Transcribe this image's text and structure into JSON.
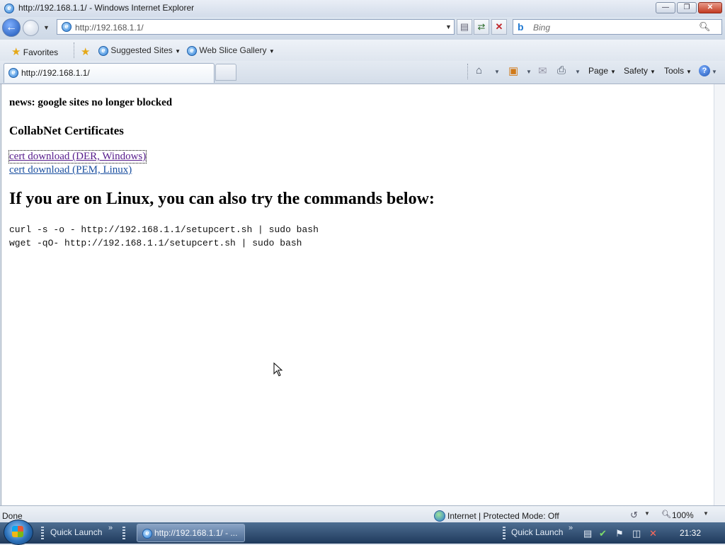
{
  "window": {
    "title": "http://192.168.1.1/ - Windows Internet Explorer",
    "minimize": "—",
    "maximize": "❐",
    "close": "✕"
  },
  "address_bar": {
    "url": "http://192.168.1.1/",
    "search_placeholder": "Bing"
  },
  "favorites_bar": {
    "favorites": "Favorites",
    "suggested_sites": "Suggested Sites",
    "web_slice_gallery": "Web Slice Gallery"
  },
  "tabs": [
    {
      "label": "http://192.168.1.1/"
    }
  ],
  "command_bar": {
    "page": "Page",
    "safety": "Safety",
    "tools": "Tools"
  },
  "page": {
    "news": "news: google sites no longer blocked",
    "heading_certs": "CollabNet Certificates",
    "link_der": "cert download (DER, Windows)",
    "link_pem": "cert download (PEM, Linux)",
    "heading_linux": "If you are on Linux, you can also try the commands below:",
    "command_1": "curl -s -o - http://192.168.1.1/setupcert.sh | sudo bash",
    "command_2": "wget -qO- http://192.168.1.1/setupcert.sh | sudo bash"
  },
  "status_bar": {
    "status": "Done",
    "zone": "Internet | Protected Mode: Off",
    "zoom": "100%"
  },
  "taskbar": {
    "quick_launch_left": "Quick Launch",
    "task_ie": "http://192.168.1.1/ - ...",
    "quick_launch_right": "Quick Launch",
    "clock": "21:32"
  },
  "colors": {
    "visited_link": "#551a8b",
    "link": "#1a4fa0",
    "close_button": "#c23b22",
    "taskbar": "#1f3a5c"
  }
}
